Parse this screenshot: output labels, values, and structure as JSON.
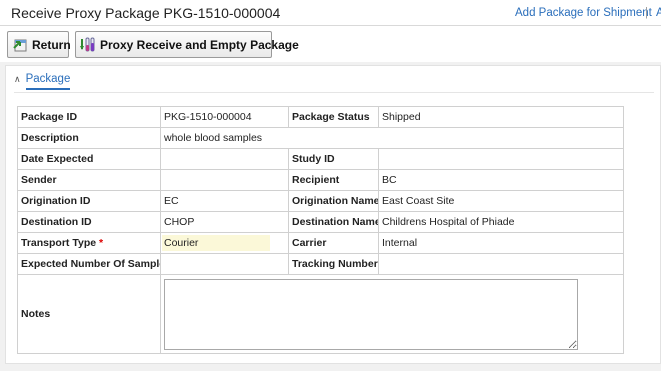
{
  "header": {
    "title": "Receive Proxy Package PKG-1510-000004",
    "link_add_package": "Add Package for Shipment",
    "separator": "|",
    "link_partial": "A"
  },
  "toolbar": {
    "return_label": "Return",
    "proxy_label": "Proxy Receive and Empty Package"
  },
  "section": {
    "label": "Package",
    "expanded": true
  },
  "fields": {
    "package_id_label": "Package ID",
    "package_id": "PKG-1510-000004",
    "package_status_label": "Package Status",
    "package_status": "Shipped",
    "description_label": "Description",
    "description": "whole blood samples",
    "date_expected_label": "Date Expected",
    "date_expected": "",
    "study_id_label": "Study ID",
    "study_id": "",
    "sender_label": "Sender",
    "sender": "",
    "recipient_label": "Recipient",
    "recipient": "BC",
    "origination_id_label": "Origination ID",
    "origination_id": "EC",
    "origination_name_label": "Origination Name",
    "origination_name": "East Coast Site",
    "destination_id_label": "Destination ID",
    "destination_id": "CHOP",
    "destination_name_label": "Destination Name",
    "destination_name": "Childrens Hospital of Phiadе",
    "transport_type_label": "Transport Type",
    "required_marker": "*",
    "transport_type": "Courier",
    "carrier_label": "Carrier",
    "carrier": "Internal",
    "expected_samples_label": "Expected Number Of Samples",
    "expected_samples": "",
    "tracking_number_label": "Tracking Number",
    "tracking_number": "",
    "notes_label": "Notes",
    "notes": ""
  },
  "icons": {
    "return": "return-arrow-icon",
    "proxy": "test-tubes-icon",
    "section": "chevron-up-icon"
  },
  "colors": {
    "link": "#2a6ebb",
    "required": "#dd0000",
    "highlight_field": "#fbf8d8"
  }
}
